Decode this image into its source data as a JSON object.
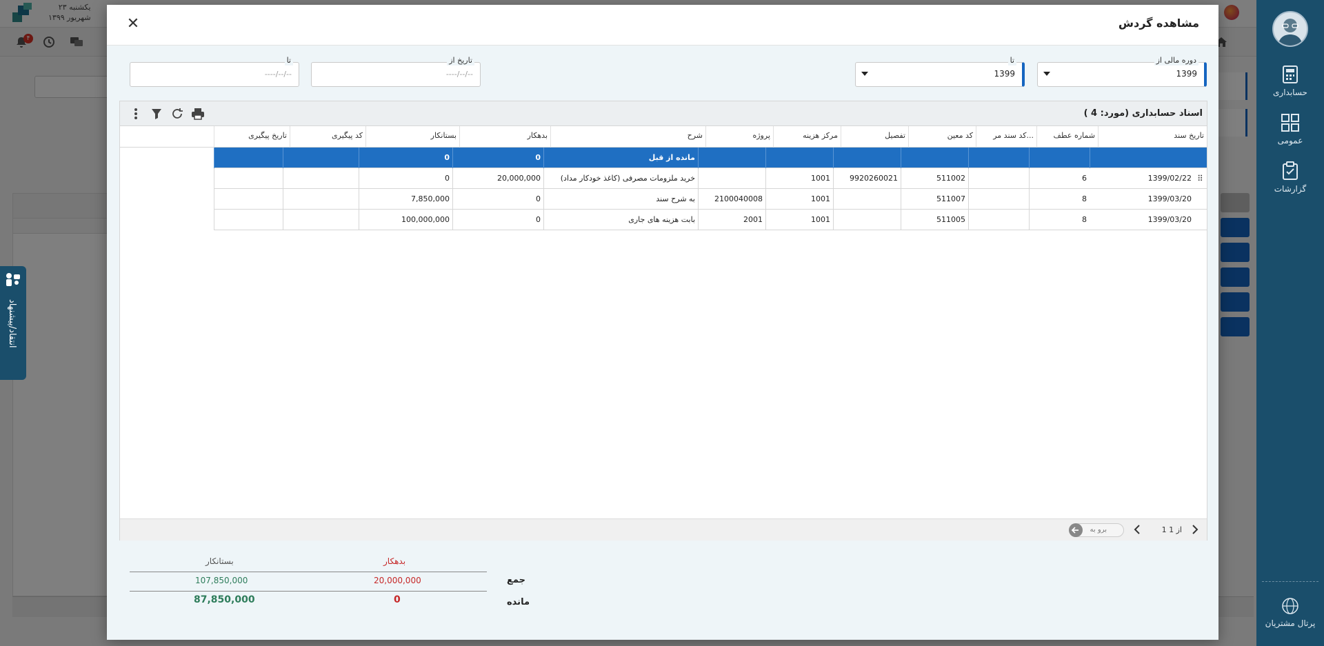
{
  "app": {
    "date_weekday": "یکشنبه ۲۳",
    "date_month": "شهریور ۱۳۹۹",
    "notification_count": "۴"
  },
  "sidebar": {
    "items": [
      {
        "label": "حسابداری",
        "icon": "accounting-icon"
      },
      {
        "label": "عمومی",
        "icon": "general-icon"
      },
      {
        "label": "گزارشات",
        "icon": "reports-icon"
      }
    ],
    "portal_label": "پرتال مشتریان"
  },
  "feedback_tab": {
    "label": "انتقاد/پیشنهاد"
  },
  "modal": {
    "title": "مشاهده گردش",
    "close_icon": "close-icon",
    "filters": {
      "fiscal_from": {
        "label": "دوره مالی از",
        "value": "1399"
      },
      "fiscal_to": {
        "label": "تا",
        "value": "1399"
      },
      "date_from": {
        "label": "تاریخ از",
        "placeholder": "----/--/--"
      },
      "date_to": {
        "label": "تا",
        "placeholder": "----/--/--"
      }
    },
    "grid": {
      "title": "اسناد حسابداری (مورد: 4 )",
      "columns": [
        "تاریخ سند",
        "شماره عطف",
        "کد سند مر...",
        "کد معین",
        "تفصیل",
        "مرکز هزینه",
        "پروژه",
        "شرح",
        "بدهکار",
        "بستانکار",
        "کد پیگیری",
        "تاریخ پیگیری"
      ],
      "previous_balance": {
        "description": "مانده از قبل",
        "debit": "0",
        "credit": "0"
      },
      "rows": [
        {
          "date": "1399/02/22",
          "ref": "6",
          "doc_code": "",
          "moein": "511002",
          "tafsil": "9920260021",
          "cost_center": "1001",
          "project": "",
          "desc": "خرید ملزومات مصرفی (کاغذ خودکار مداد)",
          "debit": "20,000,000",
          "credit": "0",
          "track_code": "",
          "track_date": ""
        },
        {
          "date": "1399/03/20",
          "ref": "8",
          "doc_code": "",
          "moein": "511007",
          "tafsil": "",
          "cost_center": "1001",
          "project": "2100040008",
          "desc": "به شرح سند",
          "debit": "0",
          "credit": "7,850,000",
          "track_code": "",
          "track_date": ""
        },
        {
          "date": "1399/03/20",
          "ref": "8",
          "doc_code": "",
          "moein": "511005",
          "tafsil": "",
          "cost_center": "1001",
          "project": "2001",
          "desc": "بابت هزینه های جاری",
          "debit": "0",
          "credit": "100,000,000",
          "track_code": "",
          "track_date": ""
        }
      ],
      "pager": {
        "page_info": "1 از 1",
        "goto_placeholder": "برو به"
      }
    },
    "totals": {
      "debit_label": "بدهکار",
      "credit_label": "بستانکار",
      "sum_label": "جمع",
      "balance_label": "مانده",
      "sum_debit": "20,000,000",
      "sum_credit": "107,850,000",
      "balance_debit": "0",
      "balance_credit": "87,850,000"
    }
  },
  "colors": {
    "sidebar": "#1a4e6b",
    "accent_blue": "#1f6fc2",
    "debit_red": "#c62828",
    "credit_green": "#2e7d5b"
  }
}
